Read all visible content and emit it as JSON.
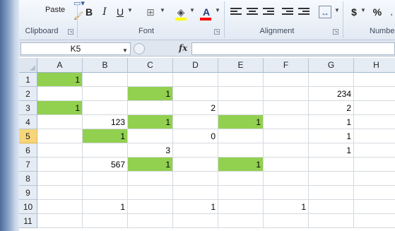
{
  "ribbon": {
    "clipboard": {
      "paste_label": "Paste",
      "group_label": "Clipboard"
    },
    "font": {
      "group_label": "Font",
      "bold": "B",
      "italic": "I",
      "underline": "U",
      "font_color_letter": "A",
      "font_color_bar": "#ff0000",
      "fill_color_bar": "#ffff00"
    },
    "alignment": {
      "group_label": "Alignment"
    },
    "number": {
      "group_label": "Numbe",
      "currency": "$",
      "percent": "%"
    }
  },
  "formula_bar": {
    "name_box": "K5",
    "fx_label": "fx",
    "formula": ""
  },
  "sheet": {
    "columns": [
      "A",
      "B",
      "C",
      "D",
      "E",
      "F",
      "G",
      "H"
    ],
    "rows": [
      "1",
      "2",
      "3",
      "4",
      "5",
      "6",
      "7",
      "8",
      "9",
      "10",
      "11"
    ],
    "selected_row": "5",
    "highlight_color": "#92d050",
    "cells": [
      [
        "1",
        "",
        "",
        "",
        "",
        "",
        "",
        ""
      ],
      [
        "",
        "",
        "1",
        "",
        "",
        "",
        "234",
        ""
      ],
      [
        "1",
        "",
        "",
        "2",
        "",
        "",
        "2",
        ""
      ],
      [
        "",
        "123",
        "1",
        "",
        "1",
        "",
        "1",
        ""
      ],
      [
        "",
        "1",
        "",
        "0",
        "",
        "",
        "1",
        ""
      ],
      [
        "",
        "",
        "3",
        "",
        "",
        "",
        "1",
        ""
      ],
      [
        "",
        "567",
        "1",
        "",
        "1",
        "",
        "",
        ""
      ],
      [
        "",
        "",
        "",
        "",
        "",
        "",
        "",
        ""
      ],
      [
        "",
        "",
        "",
        "",
        "",
        "",
        "",
        ""
      ],
      [
        "",
        "1",
        "",
        "1",
        "",
        "1",
        "",
        ""
      ],
      [
        "",
        "",
        "",
        "",
        "",
        "",
        "",
        ""
      ]
    ],
    "highlighted": [
      [
        true,
        false,
        false,
        false,
        false,
        false,
        false,
        false
      ],
      [
        false,
        false,
        true,
        false,
        false,
        false,
        false,
        false
      ],
      [
        true,
        false,
        false,
        false,
        false,
        false,
        false,
        false
      ],
      [
        false,
        false,
        true,
        false,
        true,
        false,
        false,
        false
      ],
      [
        false,
        true,
        false,
        false,
        false,
        false,
        false,
        false
      ],
      [
        false,
        false,
        false,
        false,
        false,
        false,
        false,
        false
      ],
      [
        false,
        false,
        true,
        false,
        true,
        false,
        false,
        false
      ],
      [
        false,
        false,
        false,
        false,
        false,
        false,
        false,
        false
      ],
      [
        false,
        false,
        false,
        false,
        false,
        false,
        false,
        false
      ],
      [
        false,
        false,
        false,
        false,
        false,
        false,
        false,
        false
      ],
      [
        false,
        false,
        false,
        false,
        false,
        false,
        false,
        false
      ]
    ]
  }
}
